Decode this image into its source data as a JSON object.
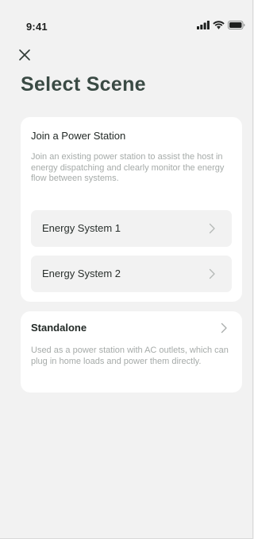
{
  "status_bar": {
    "time": "9:41",
    "icons": [
      "signal-icon",
      "wifi-icon",
      "battery-icon"
    ]
  },
  "header": {
    "close_icon": "close-icon",
    "title": "Select Scene"
  },
  "join_card": {
    "title": "Join a Power Station",
    "description": "Join an existing power station to assist the host in energy dispatching and clearly monitor the energy flow between systems.",
    "systems": [
      {
        "label": "Energy System 1",
        "icon": "chevron-right-icon"
      },
      {
        "label": "Energy System 2",
        "icon": "chevron-right-icon"
      }
    ]
  },
  "standalone_card": {
    "title": "Standalone",
    "description": "Used as a power station with AC outlets, which can plug in home loads and power them directly.",
    "icon": "chevron-right-icon"
  },
  "colors": {
    "background": "#f2f2f2",
    "card": "#ffffff",
    "title": "#3a4a44",
    "muted_text": "#a6aba9",
    "item_bg": "#f2f2f2"
  }
}
